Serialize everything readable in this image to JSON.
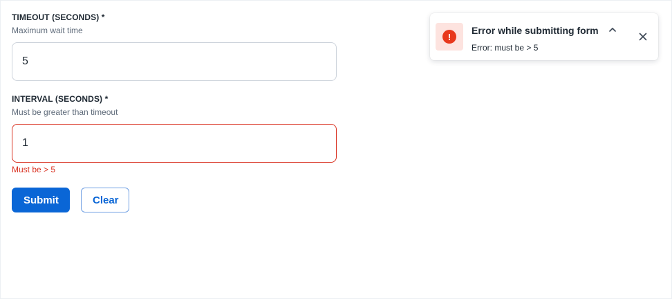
{
  "form": {
    "timeout": {
      "label": "TIMEOUT (SECONDS) *",
      "help": "Maximum wait time",
      "value": "5"
    },
    "interval": {
      "label": "INTERVAL (SECONDS) *",
      "help": "Must be greater than timeout",
      "value": "1",
      "error": "Must be > 5"
    },
    "actions": {
      "submit_label": "Submit",
      "clear_label": "Clear"
    }
  },
  "toast": {
    "title": "Error while submitting form",
    "message": "Error: must be > 5",
    "icon": "error-icon",
    "icon_glyph": "!"
  },
  "colors": {
    "primary": "#0a66d6",
    "error": "#d93020",
    "error_icon": "#e8381c",
    "error_icon_bg": "#fde3df"
  }
}
